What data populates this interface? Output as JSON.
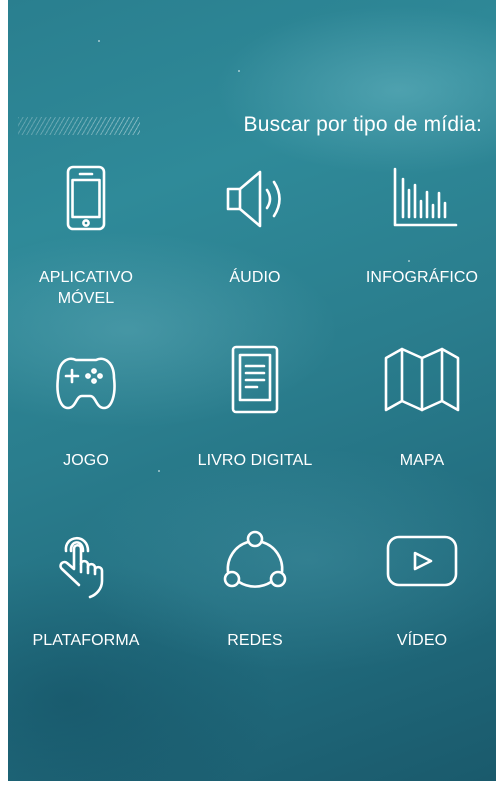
{
  "heading": "Buscar por tipo de mídia:",
  "items": [
    {
      "label": "APLICATIVO\nMÓVEL",
      "icon": "smartphone-icon"
    },
    {
      "label": "ÁUDIO",
      "icon": "speaker-icon"
    },
    {
      "label": "INFOGRÁFICO",
      "icon": "bar-chart-icon"
    },
    {
      "label": "JOGO",
      "icon": "gamepad-icon"
    },
    {
      "label": "LIVRO DIGITAL",
      "icon": "ebook-icon"
    },
    {
      "label": "MAPA",
      "icon": "map-icon"
    },
    {
      "label": "PLATAFORMA",
      "icon": "touch-hand-icon"
    },
    {
      "label": "REDES",
      "icon": "network-icon"
    },
    {
      "label": "VÍDEO",
      "icon": "play-video-icon"
    }
  ],
  "colors": {
    "panel_background": "#2a7d8d",
    "foreground": "#ffffff"
  }
}
